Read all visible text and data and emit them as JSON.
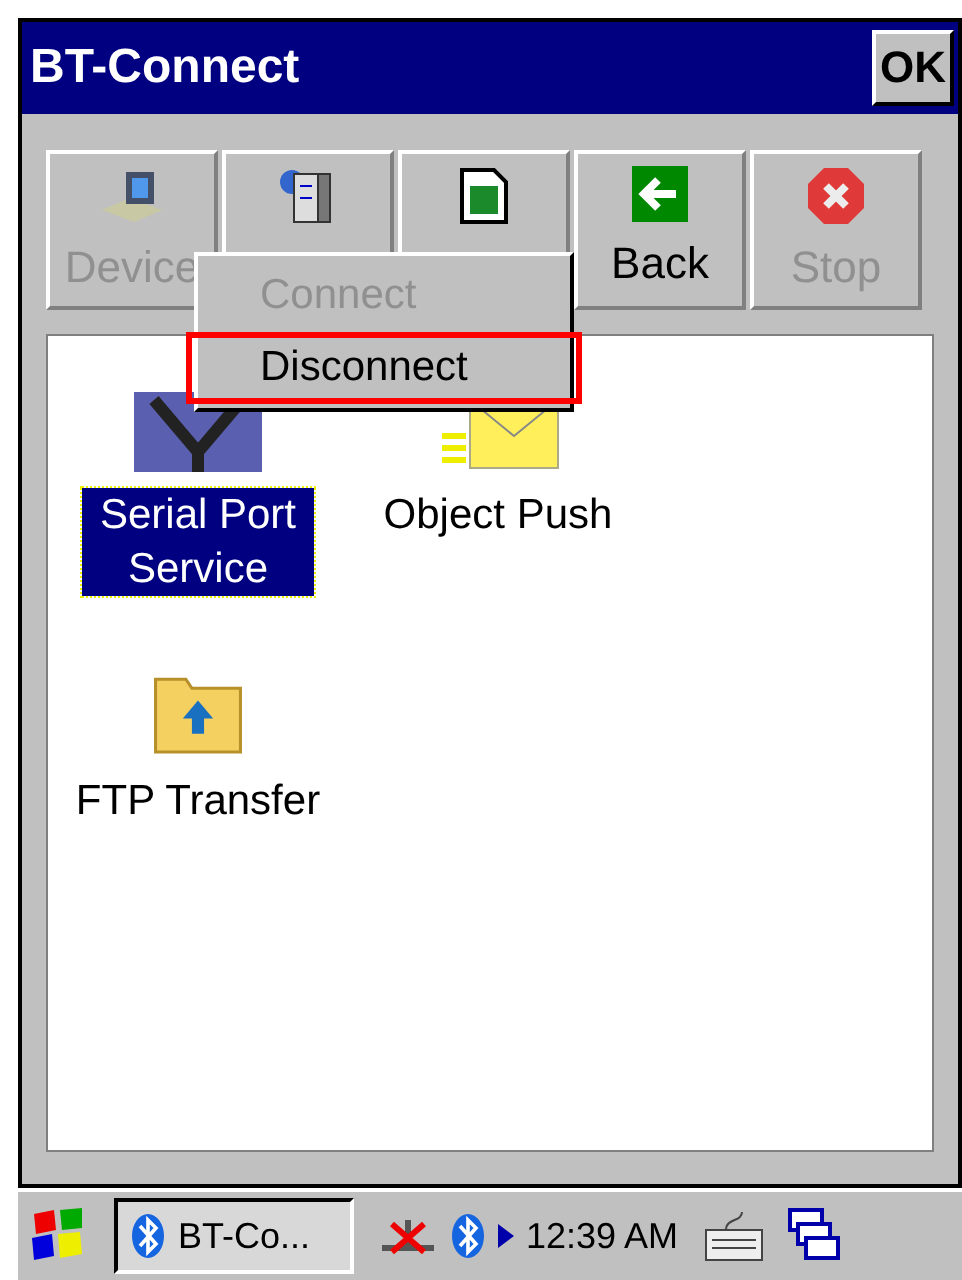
{
  "window": {
    "title": "BT-Connect",
    "ok_button": "OK"
  },
  "toolbar": [
    {
      "label": "Device",
      "disabled": true,
      "kind": "laptop"
    },
    {
      "disabled": false,
      "kind": "server"
    },
    {
      "disabled": false,
      "kind": "document"
    },
    {
      "label": "Back",
      "disabled": false,
      "kind": "back"
    },
    {
      "label": "Stop",
      "disabled": true,
      "kind": "stop"
    }
  ],
  "context_menu": [
    {
      "label": "Connect",
      "disabled": true,
      "selected": false
    },
    {
      "label": "Disconnect",
      "disabled": false,
      "selected": true
    }
  ],
  "services": [
    {
      "label": "Serial Port Service",
      "selected": true,
      "kind": "serial"
    },
    {
      "label": "Object Push",
      "selected": false,
      "kind": "envelope"
    },
    {
      "label": "FTP Transfer",
      "selected": false,
      "kind": "folder"
    }
  ],
  "taskbar": {
    "task": "BT-Co...",
    "time": "12:39 AM"
  }
}
